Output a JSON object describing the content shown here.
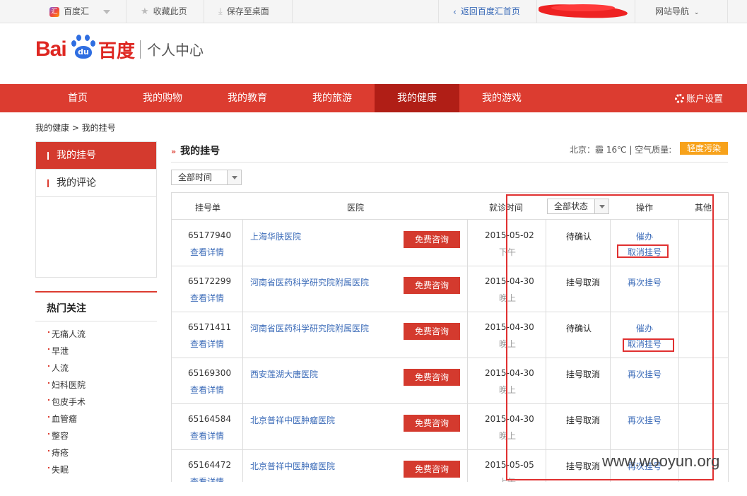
{
  "topbar": {
    "baiduhui": "百度汇",
    "bookmark": "收藏此页",
    "save_desktop": "保存至桌面",
    "back_home": "返回百度汇首页",
    "site_nav": "网站导航"
  },
  "header": {
    "logo_latin": "Bai",
    "logo_du": "du",
    "logo_cn": "百度",
    "center_title": "个人中心"
  },
  "nav": {
    "items": [
      "首页",
      "我的购物",
      "我的教育",
      "我的旅游",
      "我的健康",
      "我的游戏"
    ],
    "active_index": 4,
    "settings": "账户设置"
  },
  "breadcrumb": "我的健康 > 我的挂号",
  "sidebar": {
    "items": [
      "我的挂号",
      "我的评论"
    ],
    "hot_title": "热门关注",
    "hot_items": [
      "无痛人流",
      "早泄",
      "人流",
      "妇科医院",
      "包皮手术",
      "血管瘤",
      "整容",
      "痔疮",
      "失眠"
    ]
  },
  "main": {
    "title": "我的挂号",
    "weather": "北京：霾 16℃  |  空气质量:",
    "air_quality": "轻度污染",
    "time_filter": "全部时间",
    "status_filter": "全部状态"
  },
  "table": {
    "headers": {
      "order": "挂号单",
      "hospital": "医院",
      "time": "就诊时间",
      "action": "操作",
      "other": "其他"
    },
    "detail_label": "查看详情",
    "consult_label": "免费咨询",
    "rows": [
      {
        "no": "65177940",
        "hospital": "上海华肤医院",
        "date": "2015-05-02",
        "period": "下午",
        "status": "待确认",
        "op1": "催办",
        "op2": "取消挂号"
      },
      {
        "no": "65172299",
        "hospital": "河南省医药科学研究院附属医院",
        "date": "2015-04-30",
        "period": "晚上",
        "status": "挂号取消",
        "op1": "",
        "op2": "再次挂号"
      },
      {
        "no": "65171411",
        "hospital": "河南省医药科学研究院附属医院",
        "date": "2015-04-30",
        "period": "晚上",
        "status": "待确认",
        "op1": "催办",
        "op2": "取消挂号"
      },
      {
        "no": "65169300",
        "hospital": "西安莲湖大唐医院",
        "date": "2015-04-30",
        "period": "晚上",
        "status": "挂号取消",
        "op1": "",
        "op2": "再次挂号"
      },
      {
        "no": "65164584",
        "hospital": "北京普祥中医肿瘤医院",
        "date": "2015-04-30",
        "period": "晚上",
        "status": "挂号取消",
        "op1": "",
        "op2": "再次挂号"
      },
      {
        "no": "65164472",
        "hospital": "北京普祥中医肿瘤医院",
        "date": "2015-05-05",
        "period": "上午",
        "status": "挂号取消",
        "op1": "",
        "op2": "再次挂号"
      }
    ]
  },
  "watermark": "www.wooyun.org",
  "colors": {
    "brand_red": "#dc3c30",
    "nav_active": "#b01e16",
    "link_blue": "#3b6bb8",
    "aq_orange": "#f7a21b",
    "annotation": "#e03030"
  }
}
